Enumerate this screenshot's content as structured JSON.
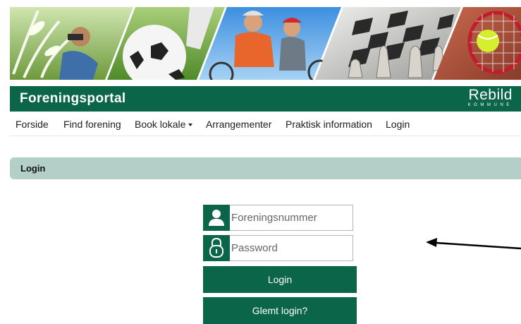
{
  "header": {
    "title": "Foreningsportal",
    "logo_main": "Rebild",
    "logo_sub": "KOMMUNE"
  },
  "nav": {
    "items": [
      {
        "label": "Forside"
      },
      {
        "label": "Find forening"
      },
      {
        "label": "Book lokale"
      },
      {
        "label": "Arrangementer"
      },
      {
        "label": "Praktisk information"
      },
      {
        "label": "Login"
      }
    ]
  },
  "section": {
    "title": "Login"
  },
  "form": {
    "username_placeholder": "Foreningsnummer",
    "username_value": "",
    "password_placeholder": "Password",
    "password_value": "",
    "login_label": "Login",
    "forgot_label": "Glemt login?"
  },
  "colors": {
    "brand": "#0b6548",
    "section_bar": "#b4cfc7",
    "annotation": "#000000"
  },
  "icons": {
    "username": "user-icon",
    "password": "lock-icon",
    "annotation": "arrow-left-icon"
  }
}
